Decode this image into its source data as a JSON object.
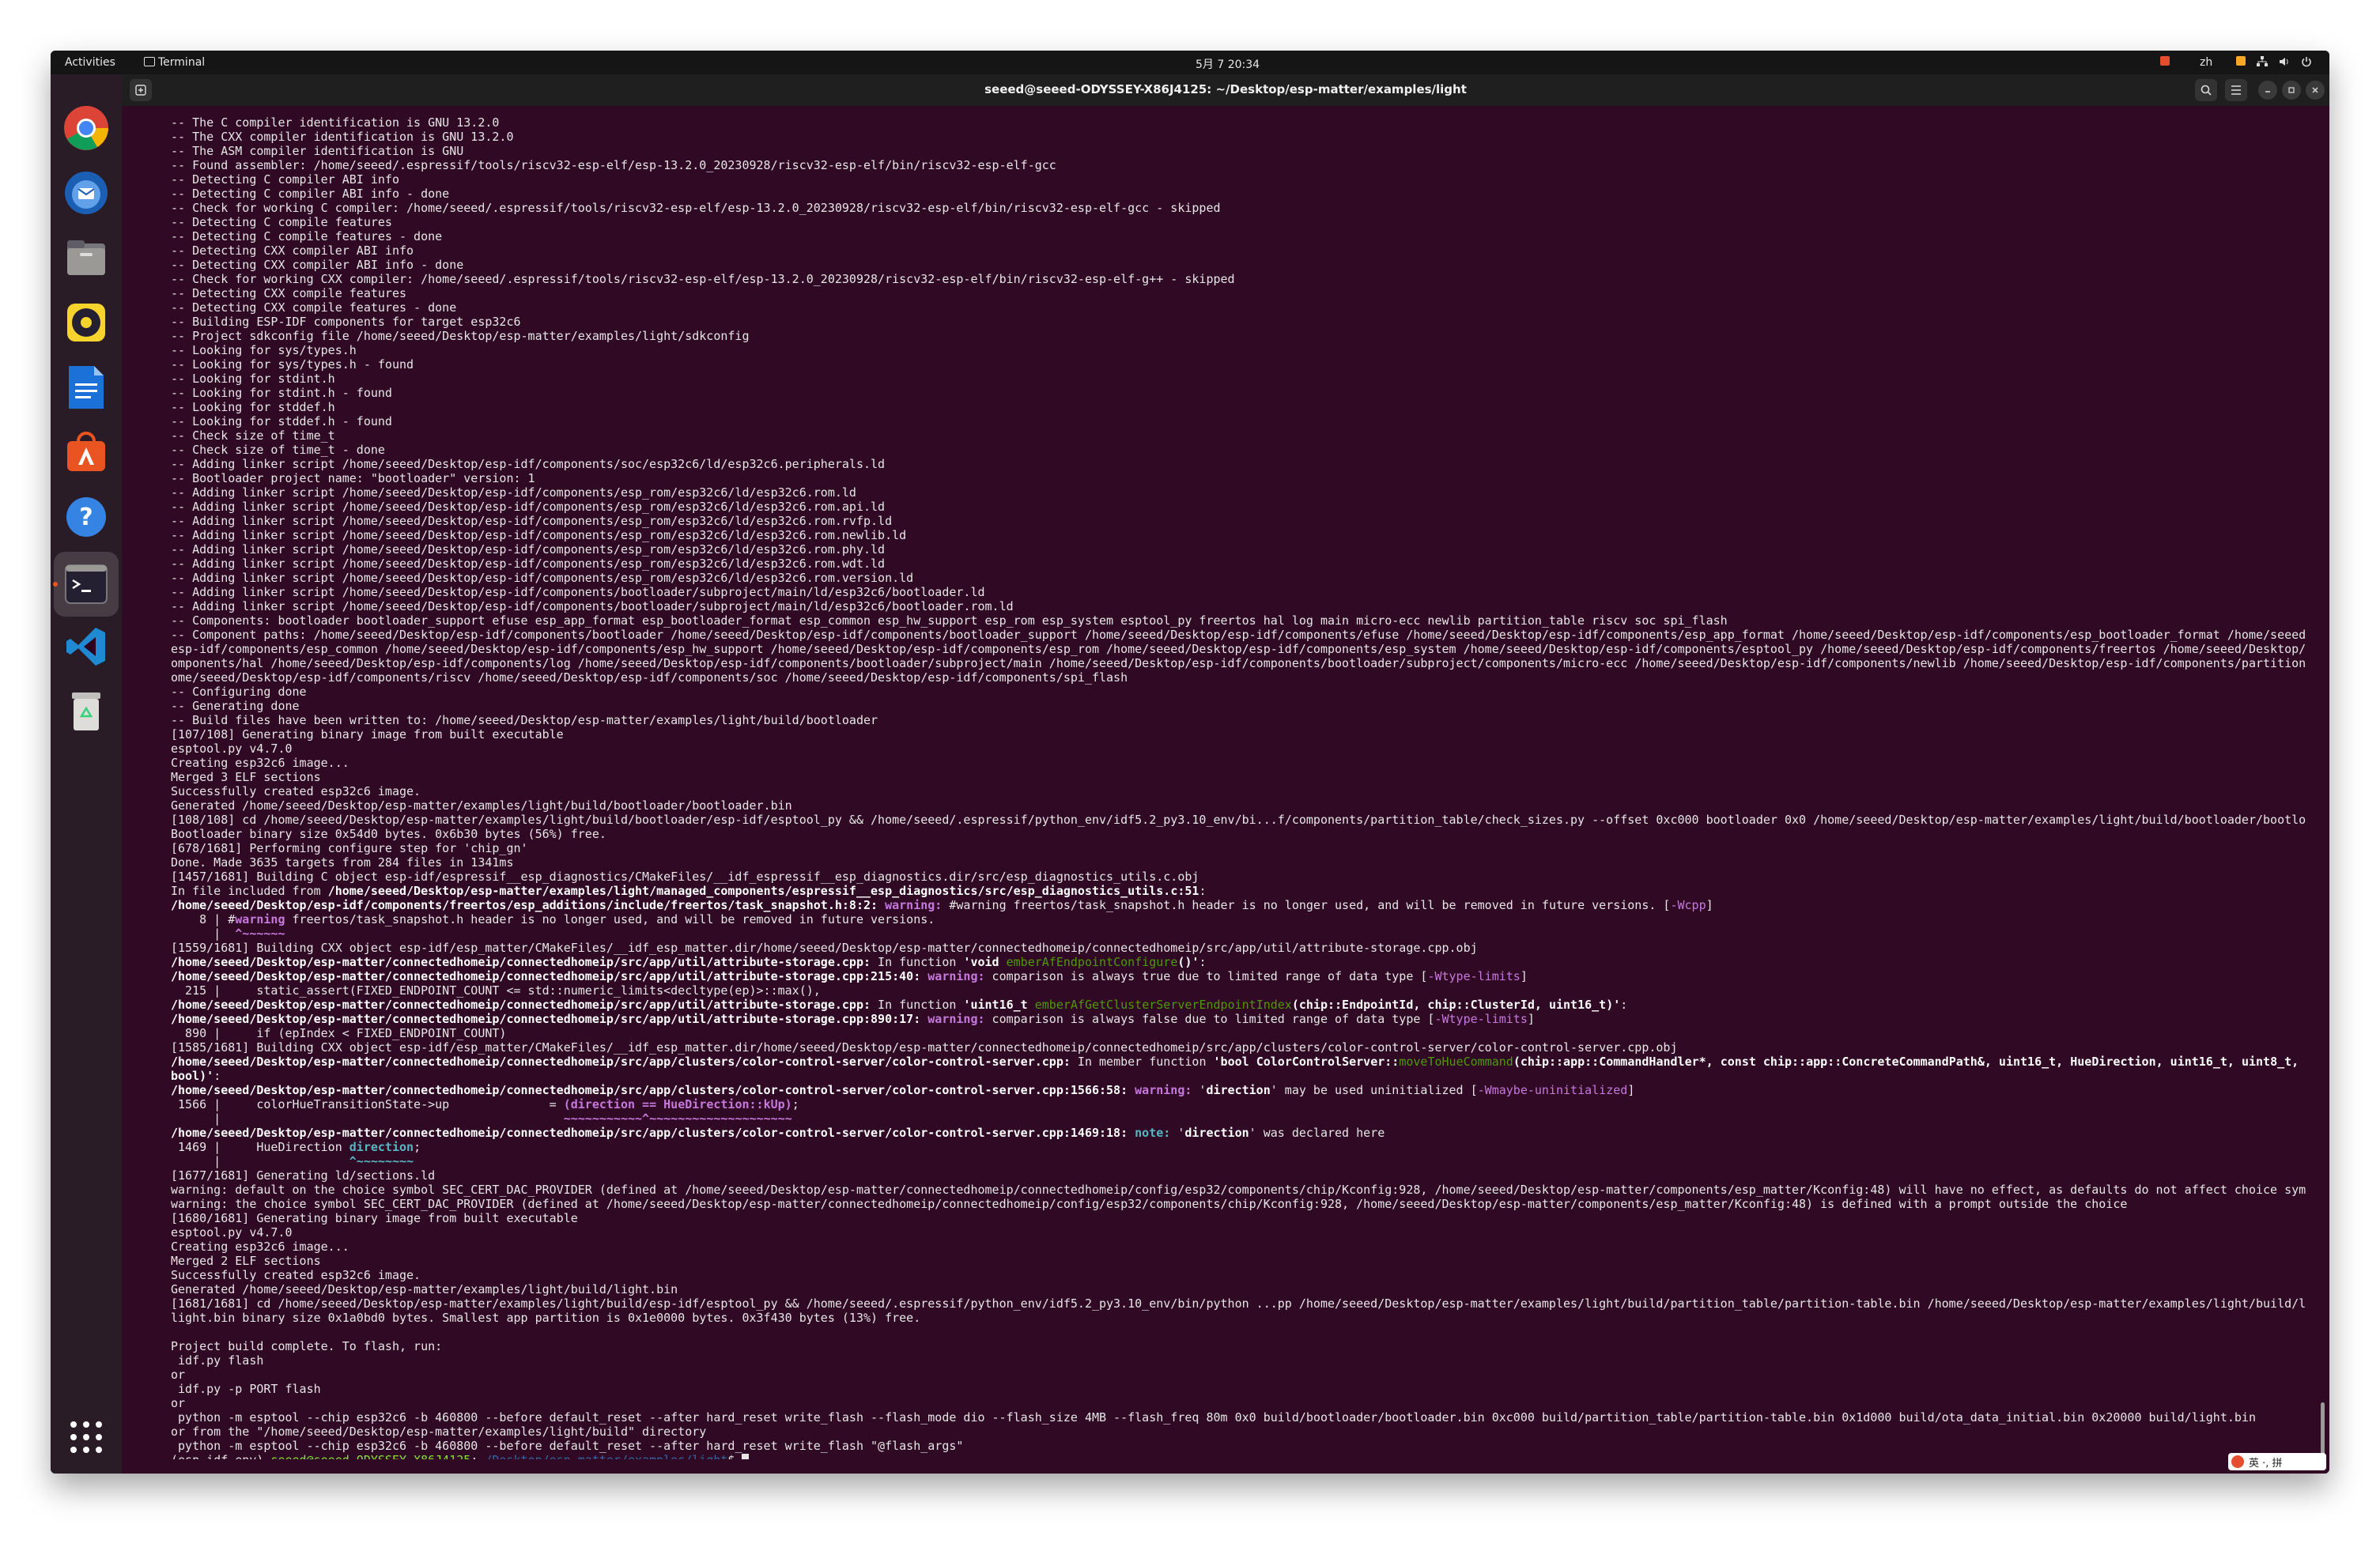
{
  "topbar": {
    "activities": "Activities",
    "app_name": "Terminal",
    "clock": "5月 7 20:34",
    "lang": "zh"
  },
  "dock": {
    "apps": [
      {
        "name": "chrome-icon"
      },
      {
        "name": "thunderbird-icon"
      },
      {
        "name": "files-icon"
      },
      {
        "name": "rhythmbox-icon"
      },
      {
        "name": "writer-icon"
      },
      {
        "name": "app-center-icon"
      },
      {
        "name": "help-icon"
      },
      {
        "name": "terminal-icon"
      },
      {
        "name": "vscode-icon"
      },
      {
        "name": "trash-icon"
      }
    ],
    "show_apps_icon": "show-apps-icon"
  },
  "window": {
    "title": "seeed@seeed-ODYSSEY-X86J4125: ~/Desktop/esp-matter/examples/light"
  },
  "terminal": {
    "lines": [
      [
        {
          "t": "-- The C compiler identification is GNU 13.2.0"
        }
      ],
      [
        {
          "t": "-- The CXX compiler identification is GNU 13.2.0"
        }
      ],
      [
        {
          "t": "-- The ASM compiler identification is GNU"
        }
      ],
      [
        {
          "t": "-- Found assembler: /home/seeed/.espressif/tools/riscv32-esp-elf/esp-13.2.0_20230928/riscv32-esp-elf/bin/riscv32-esp-elf-gcc"
        }
      ],
      [
        {
          "t": "-- Detecting C compiler ABI info"
        }
      ],
      [
        {
          "t": "-- Detecting C compiler ABI info - done"
        }
      ],
      [
        {
          "t": "-- Check for working C compiler: /home/seeed/.espressif/tools/riscv32-esp-elf/esp-13.2.0_20230928/riscv32-esp-elf/bin/riscv32-esp-elf-gcc - skipped"
        }
      ],
      [
        {
          "t": "-- Detecting C compile features"
        }
      ],
      [
        {
          "t": "-- Detecting C compile features - done"
        }
      ],
      [
        {
          "t": "-- Detecting CXX compiler ABI info"
        }
      ],
      [
        {
          "t": "-- Detecting CXX compiler ABI info - done"
        }
      ],
      [
        {
          "t": "-- Check for working CXX compiler: /home/seeed/.espressif/tools/riscv32-esp-elf/esp-13.2.0_20230928/riscv32-esp-elf/bin/riscv32-esp-elf-g++ - skipped"
        }
      ],
      [
        {
          "t": "-- Detecting CXX compile features"
        }
      ],
      [
        {
          "t": "-- Detecting CXX compile features - done"
        }
      ],
      [
        {
          "t": "-- Building ESP-IDF components for target esp32c6"
        }
      ],
      [
        {
          "t": "-- Project sdkconfig file /home/seeed/Desktop/esp-matter/examples/light/sdkconfig"
        }
      ],
      [
        {
          "t": "-- Looking for sys/types.h"
        }
      ],
      [
        {
          "t": "-- Looking for sys/types.h - found"
        }
      ],
      [
        {
          "t": "-- Looking for stdint.h"
        }
      ],
      [
        {
          "t": "-- Looking for stdint.h - found"
        }
      ],
      [
        {
          "t": "-- Looking for stddef.h"
        }
      ],
      [
        {
          "t": "-- Looking for stddef.h - found"
        }
      ],
      [
        {
          "t": "-- Check size of time_t"
        }
      ],
      [
        {
          "t": "-- Check size of time_t - done"
        }
      ],
      [
        {
          "t": "-- Adding linker script /home/seeed/Desktop/esp-idf/components/soc/esp32c6/ld/esp32c6.peripherals.ld"
        }
      ],
      [
        {
          "t": "-- Bootloader project name: \"bootloader\" version: 1"
        }
      ],
      [
        {
          "t": "-- Adding linker script /home/seeed/Desktop/esp-idf/components/esp_rom/esp32c6/ld/esp32c6.rom.ld"
        }
      ],
      [
        {
          "t": "-- Adding linker script /home/seeed/Desktop/esp-idf/components/esp_rom/esp32c6/ld/esp32c6.rom.api.ld"
        }
      ],
      [
        {
          "t": "-- Adding linker script /home/seeed/Desktop/esp-idf/components/esp_rom/esp32c6/ld/esp32c6.rom.rvfp.ld"
        }
      ],
      [
        {
          "t": "-- Adding linker script /home/seeed/Desktop/esp-idf/components/esp_rom/esp32c6/ld/esp32c6.rom.newlib.ld"
        }
      ],
      [
        {
          "t": "-- Adding linker script /home/seeed/Desktop/esp-idf/components/esp_rom/esp32c6/ld/esp32c6.rom.phy.ld"
        }
      ],
      [
        {
          "t": "-- Adding linker script /home/seeed/Desktop/esp-idf/components/esp_rom/esp32c6/ld/esp32c6.rom.wdt.ld"
        }
      ],
      [
        {
          "t": "-- Adding linker script /home/seeed/Desktop/esp-idf/components/esp_rom/esp32c6/ld/esp32c6.rom.version.ld"
        }
      ],
      [
        {
          "t": "-- Adding linker script /home/seeed/Desktop/esp-idf/components/bootloader/subproject/main/ld/esp32c6/bootloader.ld"
        }
      ],
      [
        {
          "t": "-- Adding linker script /home/seeed/Desktop/esp-idf/components/bootloader/subproject/main/ld/esp32c6/bootloader.rom.ld"
        }
      ],
      [
        {
          "t": "-- Components: bootloader bootloader_support efuse esp_app_format esp_bootloader_format esp_common esp_hw_support esp_rom esp_system esptool_py freertos hal log main micro-ecc newlib partition_table riscv soc spi_flash"
        }
      ],
      [
        {
          "t": "-- Component paths: /home/seeed/Desktop/esp-idf/components/bootloader /home/seeed/Desktop/esp-idf/components/bootloader_support /home/seeed/Desktop/esp-idf/components/efuse /home/seeed/Desktop/esp-idf/components/esp_app_format /home/seeed/Desktop/esp-idf/components/esp_bootloader_format /home/seeed/Desktop/"
        }
      ],
      [
        {
          "t": "esp-idf/components/esp_common /home/seeed/Desktop/esp-idf/components/esp_hw_support /home/seeed/Desktop/esp-idf/components/esp_rom /home/seeed/Desktop/esp-idf/components/esp_system /home/seeed/Desktop/esp-idf/components/esptool_py /home/seeed/Desktop/esp-idf/components/freertos /home/seeed/Desktop/esp-idf/c"
        }
      ],
      [
        {
          "t": "omponents/hal /home/seeed/Desktop/esp-idf/components/log /home/seeed/Desktop/esp-idf/components/bootloader/subproject/main /home/seeed/Desktop/esp-idf/components/bootloader/subproject/components/micro-ecc /home/seeed/Desktop/esp-idf/components/newlib /home/seeed/Desktop/esp-idf/components/partition_table /h"
        }
      ],
      [
        {
          "t": "ome/seeed/Desktop/esp-idf/components/riscv /home/seeed/Desktop/esp-idf/components/soc /home/seeed/Desktop/esp-idf/components/spi_flash"
        }
      ],
      [
        {
          "t": "-- Configuring done"
        }
      ],
      [
        {
          "t": "-- Generating done"
        }
      ],
      [
        {
          "t": "-- Build files have been written to: /home/seeed/Desktop/esp-matter/examples/light/build/bootloader"
        }
      ],
      [
        {
          "t": "[107/108] Generating binary image from built executable"
        }
      ],
      [
        {
          "t": "esptool.py v4.7.0"
        }
      ],
      [
        {
          "t": "Creating esp32c6 image..."
        }
      ],
      [
        {
          "t": "Merged 3 ELF sections"
        }
      ],
      [
        {
          "t": "Successfully created esp32c6 image."
        }
      ],
      [
        {
          "t": "Generated /home/seeed/Desktop/esp-matter/examples/light/build/bootloader/bootloader.bin"
        }
      ],
      [
        {
          "t": "[108/108] cd /home/seeed/Desktop/esp-matter/examples/light/build/bootloader/esp-idf/esptool_py && /home/seeed/.espressif/python_env/idf5.2_py3.10_env/bi...f/components/partition_table/check_sizes.py --offset 0xc000 bootloader 0x0 /home/seeed/Desktop/esp-matter/examples/light/build/bootloader/bootloader.bin"
        }
      ],
      [
        {
          "t": "Bootloader binary size 0x54d0 bytes. 0x6b30 bytes (56%) free."
        }
      ],
      [
        {
          "t": "[678/1681] Performing configure step for 'chip_gn'"
        }
      ],
      [
        {
          "t": "Done. Made 3635 targets from 284 files in 1341ms"
        }
      ],
      [
        {
          "t": "[1457/1681] Building C object esp-idf/espressif__esp_diagnostics/CMakeFiles/__idf_espressif__esp_diagnostics.dir/src/esp_diagnostics_utils.c.obj"
        }
      ],
      [
        {
          "t": "In file included from "
        },
        {
          "t": "/home/seeed/Desktop/esp-matter/examples/light/managed_components/espressif__esp_diagnostics/src/esp_diagnostics_utils.c:51",
          "c": "b"
        },
        {
          "t": ":"
        }
      ],
      [
        {
          "t": "/home/seeed/Desktop/esp-idf/components/freertos/esp_additions/include/freertos/task_snapshot.h:8:2:",
          "c": "b"
        },
        {
          "t": " "
        },
        {
          "t": "warning:",
          "c": "w"
        },
        {
          "t": " #warning freertos/task_snapshot.h header is no longer used, and will be removed in future versions. ["
        },
        {
          "t": "-Wcpp",
          "c": "flag"
        },
        {
          "t": "]"
        }
      ],
      [
        {
          "t": "    8 | #"
        },
        {
          "t": "warning",
          "c": "w"
        },
        {
          "t": " freertos/task_snapshot.h header is no longer used, and will be removed in future versions."
        }
      ],
      [
        {
          "t": "      |  "
        },
        {
          "t": "^~~~~~~",
          "c": "w"
        }
      ],
      [
        {
          "t": "[1559/1681] Building CXX object esp-idf/esp_matter/CMakeFiles/__idf_esp_matter.dir/home/seeed/Desktop/esp-matter/connectedhomeip/connectedhomeip/src/app/util/attribute-storage.cpp.obj"
        }
      ],
      [
        {
          "t": "/home/seeed/Desktop/esp-matter/connectedhomeip/connectedhomeip/src/app/util/attribute-storage.cpp:",
          "c": "b"
        },
        {
          "t": " In function "
        },
        {
          "t": "'void ",
          "c": "b"
        },
        {
          "t": "emberAfEndpointConfigure",
          "c": "fn"
        },
        {
          "t": "()'",
          "c": "b"
        },
        {
          "t": ":"
        }
      ],
      [
        {
          "t": "/home/seeed/Desktop/esp-matter/connectedhomeip/connectedhomeip/src/app/util/attribute-storage.cpp:215:40:",
          "c": "b"
        },
        {
          "t": " "
        },
        {
          "t": "warning:",
          "c": "w"
        },
        {
          "t": " comparison is always true due to limited range of data type ["
        },
        {
          "t": "-Wtype-limits",
          "c": "flag"
        },
        {
          "t": "]"
        }
      ],
      [
        {
          "t": "  215 |     static_assert(FIXED_ENDPOINT_COUNT <= std::numeric_limits<decltype(ep)>::max(),"
        }
      ],
      [
        {
          "t": "/home/seeed/Desktop/esp-matter/connectedhomeip/connectedhomeip/src/app/util/attribute-storage.cpp:",
          "c": "b"
        },
        {
          "t": " In function "
        },
        {
          "t": "'uint16_t ",
          "c": "b"
        },
        {
          "t": "emberAfGetClusterServerEndpointIndex",
          "c": "fn"
        },
        {
          "t": "(chip::EndpointId, chip::ClusterId, uint16_t)'",
          "c": "b"
        },
        {
          "t": ":"
        }
      ],
      [
        {
          "t": "/home/seeed/Desktop/esp-matter/connectedhomeip/connectedhomeip/src/app/util/attribute-storage.cpp:890:17:",
          "c": "b"
        },
        {
          "t": " "
        },
        {
          "t": "warning:",
          "c": "w"
        },
        {
          "t": " comparison is always false due to limited range of data type ["
        },
        {
          "t": "-Wtype-limits",
          "c": "flag"
        },
        {
          "t": "]"
        }
      ],
      [
        {
          "t": "  890 |     if (epIndex < FIXED_ENDPOINT_COUNT)"
        }
      ],
      [
        {
          "t": "[1585/1681] Building CXX object esp-idf/esp_matter/CMakeFiles/__idf_esp_matter.dir/home/seeed/Desktop/esp-matter/connectedhomeip/connectedhomeip/src/app/clusters/color-control-server/color-control-server.cpp.obj"
        }
      ],
      [
        {
          "t": "/home/seeed/Desktop/esp-matter/connectedhomeip/connectedhomeip/src/app/clusters/color-control-server/color-control-server.cpp:",
          "c": "b"
        },
        {
          "t": " In member function "
        },
        {
          "t": "'bool ColorControlServer::",
          "c": "b"
        },
        {
          "t": "moveToHueCommand",
          "c": "fn"
        },
        {
          "t": "(chip::app::CommandHandler*, const chip::app::ConcreteCommandPath&, uint16_t, HueDirection, uint16_t, uint8_t, uint8_t,",
          "c": "b"
        }
      ],
      [
        {
          "t": "bool)'",
          "c": "b"
        },
        {
          "t": ":"
        }
      ],
      [
        {
          "t": "/home/seeed/Desktop/esp-matter/connectedhomeip/connectedhomeip/src/app/clusters/color-control-server/color-control-server.cpp:1566:58:",
          "c": "b"
        },
        {
          "t": " "
        },
        {
          "t": "warning:",
          "c": "w"
        },
        {
          "t": " '"
        },
        {
          "t": "direction",
          "c": "b"
        },
        {
          "t": "' may be used uninitialized ["
        },
        {
          "t": "-Wmaybe-uninitialized",
          "c": "flag"
        },
        {
          "t": "]"
        }
      ],
      [
        {
          "t": " 1566 |     colorHueTransitionState->up              = "
        },
        {
          "t": "(direction == HueDirection::kUp)",
          "c": "w"
        },
        {
          "t": ";"
        }
      ],
      [
        {
          "t": "      |                                                "
        },
        {
          "t": "~~~~~~~~~~~^~~~~~~~~~~~~~~~~~~~~",
          "c": "w"
        }
      ],
      [
        {
          "t": "/home/seeed/Desktop/esp-matter/connectedhomeip/connectedhomeip/src/app/clusters/color-control-server/color-control-server.cpp:1469:18:",
          "c": "b"
        },
        {
          "t": " "
        },
        {
          "t": "note:",
          "c": "n"
        },
        {
          "t": " '"
        },
        {
          "t": "direction",
          "c": "b"
        },
        {
          "t": "' was declared here"
        }
      ],
      [
        {
          "t": " 1469 |     HueDirection "
        },
        {
          "t": "direction",
          "c": "n"
        },
        {
          "t": ";"
        }
      ],
      [
        {
          "t": "      |                  "
        },
        {
          "t": "^~~~~~~~~",
          "c": "n"
        }
      ],
      [
        {
          "t": "[1677/1681] Generating ld/sections.ld"
        }
      ],
      [
        {
          "t": "warning: default on the choice symbol SEC_CERT_DAC_PROVIDER (defined at /home/seeed/Desktop/esp-matter/connectedhomeip/connectedhomeip/config/esp32/components/chip/Kconfig:928, /home/seeed/Desktop/esp-matter/components/esp_matter/Kconfig:48) will have no effect, as defaults do not affect choice symbols"
        }
      ],
      [
        {
          "t": "warning: the choice symbol SEC_CERT_DAC_PROVIDER (defined at /home/seeed/Desktop/esp-matter/connectedhomeip/connectedhomeip/config/esp32/components/chip/Kconfig:928, /home/seeed/Desktop/esp-matter/components/esp_matter/Kconfig:48) is defined with a prompt outside the choice"
        }
      ],
      [
        {
          "t": "[1680/1681] Generating binary image from built executable"
        }
      ],
      [
        {
          "t": "esptool.py v4.7.0"
        }
      ],
      [
        {
          "t": "Creating esp32c6 image..."
        }
      ],
      [
        {
          "t": "Merged 2 ELF sections"
        }
      ],
      [
        {
          "t": "Successfully created esp32c6 image."
        }
      ],
      [
        {
          "t": "Generated /home/seeed/Desktop/esp-matter/examples/light/build/light.bin"
        }
      ],
      [
        {
          "t": "[1681/1681] cd /home/seeed/Desktop/esp-matter/examples/light/build/esp-idf/esptool_py && /home/seeed/.espressif/python_env/idf5.2_py3.10_env/bin/python ...pp /home/seeed/Desktop/esp-matter/examples/light/build/partition_table/partition-table.bin /home/seeed/Desktop/esp-matter/examples/light/build/light.bin"
        }
      ],
      [
        {
          "t": "light.bin binary size 0x1a0bd0 bytes. Smallest app partition is 0x1e0000 bytes. 0x3f430 bytes (13%) free."
        }
      ],
      [
        {
          "t": ""
        }
      ],
      [
        {
          "t": "Project build complete. To flash, run:"
        }
      ],
      [
        {
          "t": " idf.py flash"
        }
      ],
      [
        {
          "t": "or"
        }
      ],
      [
        {
          "t": " idf.py -p PORT flash"
        }
      ],
      [
        {
          "t": "or"
        }
      ],
      [
        {
          "t": " python -m esptool --chip esp32c6 -b 460800 --before default_reset --after hard_reset write_flash --flash_mode dio --flash_size 4MB --flash_freq 80m 0x0 build/bootloader/bootloader.bin 0xc000 build/partition_table/partition-table.bin 0x1d000 build/ota_data_initial.bin 0x20000 build/light.bin"
        }
      ],
      [
        {
          "t": "or from the \"/home/seeed/Desktop/esp-matter/examples/light/build\" directory"
        }
      ],
      [
        {
          "t": " python -m esptool --chip esp32c6 -b 460800 --before default_reset --after hard_reset write_flash \"@flash_args\""
        }
      ],
      [
        {
          "t": "(esp-idf-env) "
        },
        {
          "t": "seeed@seeed-ODYSSEY-X86J4125",
          "c": "g"
        },
        {
          "t": ":"
        },
        {
          "t": "~/Desktop/esp-matter/examples/light",
          "c": "bl"
        },
        {
          "t": "$ "
        }
      ]
    ]
  },
  "ime": {
    "label": "英 ·, 拼"
  }
}
